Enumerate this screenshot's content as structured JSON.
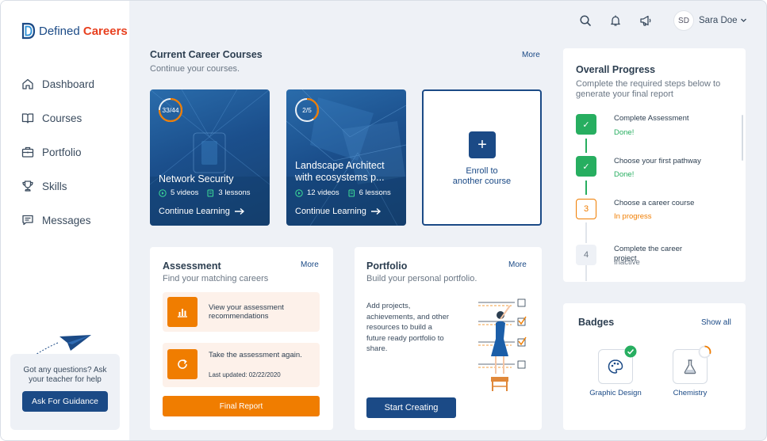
{
  "brand": {
    "prefix": "Defined",
    "suffix": "Careers",
    "primary_color": "#1b4a86",
    "accent_color": "#e8401f"
  },
  "sidebar": {
    "items": [
      {
        "label": "Dashboard",
        "icon": "home-icon"
      },
      {
        "label": "Courses",
        "icon": "book-icon"
      },
      {
        "label": "Portfolio",
        "icon": "briefcase-icon"
      },
      {
        "label": "Skills",
        "icon": "trophy-icon"
      },
      {
        "label": "Messages",
        "icon": "message-icon"
      }
    ],
    "help": {
      "text": "Got any questions? Ask your teacher for help",
      "button": "Ask For Guidance"
    }
  },
  "header": {
    "icons": [
      "search-icon",
      "bell-icon",
      "megaphone-icon"
    ],
    "user": {
      "initials": "SD",
      "name": "Sara Doe"
    }
  },
  "courses": {
    "title": "Current Career Courses",
    "subtitle": "Continue your courses.",
    "more": "More",
    "items": [
      {
        "progress_text": "33/44",
        "progress": 0.75,
        "title": "Network Security",
        "videos": "5 videos",
        "lessons": "3 lessons",
        "cta": "Continue Learning"
      },
      {
        "progress_text": "2/5",
        "progress": 0.4,
        "title": "Landscape Architect with ecosystems p...",
        "videos": "12 videos",
        "lessons": "6 lessons",
        "cta": "Continue Learning"
      }
    ],
    "enroll": {
      "line1": "Enroll to",
      "line2": "another course"
    }
  },
  "progress": {
    "title": "Overall Progress",
    "subtitle": "Complete the required steps below to generate your final report",
    "steps": [
      {
        "marker": "✓",
        "title": "Complete Assessment",
        "status": "Done!",
        "state": "done"
      },
      {
        "marker": "✓",
        "title": "Choose your first pathway",
        "status": "Done!",
        "state": "done"
      },
      {
        "marker": "3",
        "title": "Choose a career course",
        "status": "In progress",
        "state": "in-progress"
      },
      {
        "marker": "4",
        "title": "Complete the career project",
        "status": "Inactive",
        "state": "inactive"
      }
    ],
    "colors": {
      "done": "#27ae60",
      "in_progress": "#f07d00",
      "inactive": "#6b7785"
    }
  },
  "assessment": {
    "title": "Assessment",
    "subtitle": "Find your matching careers",
    "more": "More",
    "items": [
      {
        "label": "View your assessment recommendations",
        "icon": "bar-chart-icon"
      },
      {
        "label": "Take the assessment again.",
        "date": "Last updated: 02/22/2020",
        "icon": "refresh-icon"
      }
    ],
    "button": "Final Report"
  },
  "portfolio": {
    "title": "Portfolio",
    "subtitle": "Build your personal portfolio.",
    "more": "More",
    "description": "Add projects, achievements, and other resources to build a future ready portfolio to share.",
    "button": "Start Creating"
  },
  "badges": {
    "title": "Badges",
    "show_all": "Show all",
    "items": [
      {
        "label": "Graphic Design",
        "icon": "palette-icon",
        "earned": true
      },
      {
        "label": "Chemistry",
        "icon": "flask-icon",
        "progress": 0.3
      }
    ]
  }
}
